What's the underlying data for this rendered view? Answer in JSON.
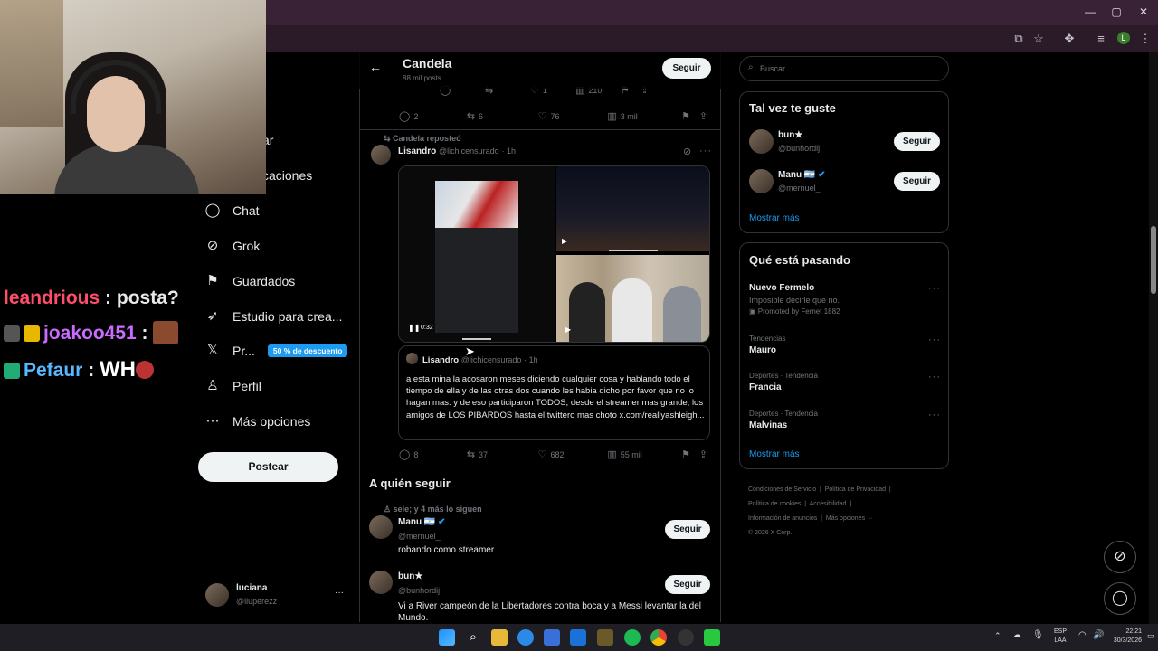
{
  "browser": {
    "window_controls": [
      "—",
      "▢",
      "✕"
    ],
    "profile_initial": "L"
  },
  "chat": [
    {
      "user": "leandrious",
      "sep": " : ",
      "message": "posta?",
      "user_color": "#ff4d6a"
    },
    {
      "user": "joakoo451",
      "sep": " : ",
      "message": "",
      "user_color": "#c86bff"
    },
    {
      "user": "Pefaur",
      "sep": " : ",
      "message": "WH",
      "user_color": "#58b8ff"
    }
  ],
  "nav": {
    "partial_items": [
      "ar",
      "caciones"
    ],
    "items": [
      {
        "label": "Chat",
        "icon": "chat-icon",
        "glyph": "◯"
      },
      {
        "label": "Grok",
        "icon": "grok-icon",
        "glyph": "⊘"
      },
      {
        "label": "Guardados",
        "icon": "bookmark-icon",
        "glyph": "⚑"
      },
      {
        "label": "Estudio para crea...",
        "icon": "rocket-icon",
        "glyph": "➶"
      },
      {
        "label": "Pr...",
        "icon": "x-logo-icon",
        "glyph": "𝕏",
        "promo": "50 % de descuento"
      },
      {
        "label": "Perfil",
        "icon": "person-icon",
        "glyph": "♙"
      },
      {
        "label": "Más opciones",
        "icon": "more-circle-icon",
        "glyph": "⋯"
      }
    ],
    "post_button": "Postear",
    "account": {
      "name": "luciana",
      "handle": "@lluperezz",
      "menu": "···"
    }
  },
  "profile_header": {
    "back": "←",
    "name": "Candela",
    "posts": "88 mil posts",
    "follow": "Seguir"
  },
  "prev_post_inner_actions": {
    "likes": "1",
    "views": "210"
  },
  "prev_post_actions": {
    "replies": "2",
    "reposts": "6",
    "likes": "76",
    "views": "3 mil"
  },
  "repost": {
    "reposted_by": "Candela reposteó",
    "name": "Lisandro",
    "handle": "@lichicensurado",
    "time": "· 1h",
    "video": {
      "time": "0:32"
    },
    "quote": {
      "name": "Lisandro",
      "handle": "@lichicensurado",
      "time": "· 1h",
      "text": "a esta mina la acosaron meses diciendo cualquier cosa y hablando todo el tiempo de ella y de las otras dos cuando les habia dicho por favor que no lo hagan mas. y de eso participaron TODOS, desde el streamer mas grande, los amigos de LOS PIBARDOS hasta el twittero mas choto x.com/reallyashleigh..."
    },
    "actions": {
      "replies": "8",
      "reposts": "37",
      "likes": "682",
      "views": "55 mil"
    }
  },
  "who_to_follow": {
    "title": "A quién seguir",
    "social_context": "sele; y 4 más lo siguen",
    "users": [
      {
        "name": "Manu 🇦🇷",
        "handle": "@mernuel_",
        "bio": "robando como streamer",
        "follow": "Seguir",
        "verified": true
      },
      {
        "name": "bun★",
        "handle": "@bunhordij",
        "bio": "Vi a River campeón de la Libertadores contra boca y a Messi levantar la del Mundo.",
        "follow": "Seguir",
        "verified": false
      }
    ]
  },
  "sidebar": {
    "search_placeholder": "Buscar",
    "suggest": {
      "title": "Tal vez te guste",
      "users": [
        {
          "name": "bun★",
          "handle": "@bunhordij",
          "follow": "Seguir",
          "verified": false
        },
        {
          "name": "Manu 🇦🇷",
          "handle": "@mernuel_",
          "follow": "Seguir",
          "verified": true
        }
      ],
      "more": "Mostrar más"
    },
    "trends": {
      "title": "Qué está pasando",
      "items": [
        {
          "category": "",
          "name": "Nuevo Fermelo",
          "desc": "Imposible decirle que no.",
          "promo": "Promoted by Fernet 1882"
        },
        {
          "category": "Tendencias",
          "name": "Mauro"
        },
        {
          "category": "Deportes · Tendencia",
          "name": "Francia"
        },
        {
          "category": "Deportes · Tendencia",
          "name": "Malvinas"
        }
      ],
      "more": "Mostrar más"
    },
    "footer": [
      "Condiciones de Servicio",
      "Política de Privacidad",
      "Política de cookies",
      "Accesibilidad",
      "Información de anuncios",
      "Más opciones ···",
      "© 2026 X Corp."
    ]
  },
  "taskbar": {
    "lang": "ESP",
    "lang2": "LAA",
    "time": "22:21",
    "date": "30/3/2026"
  },
  "colors": {
    "accent": "#1d9bf0",
    "titlebar": "#3a2236"
  }
}
